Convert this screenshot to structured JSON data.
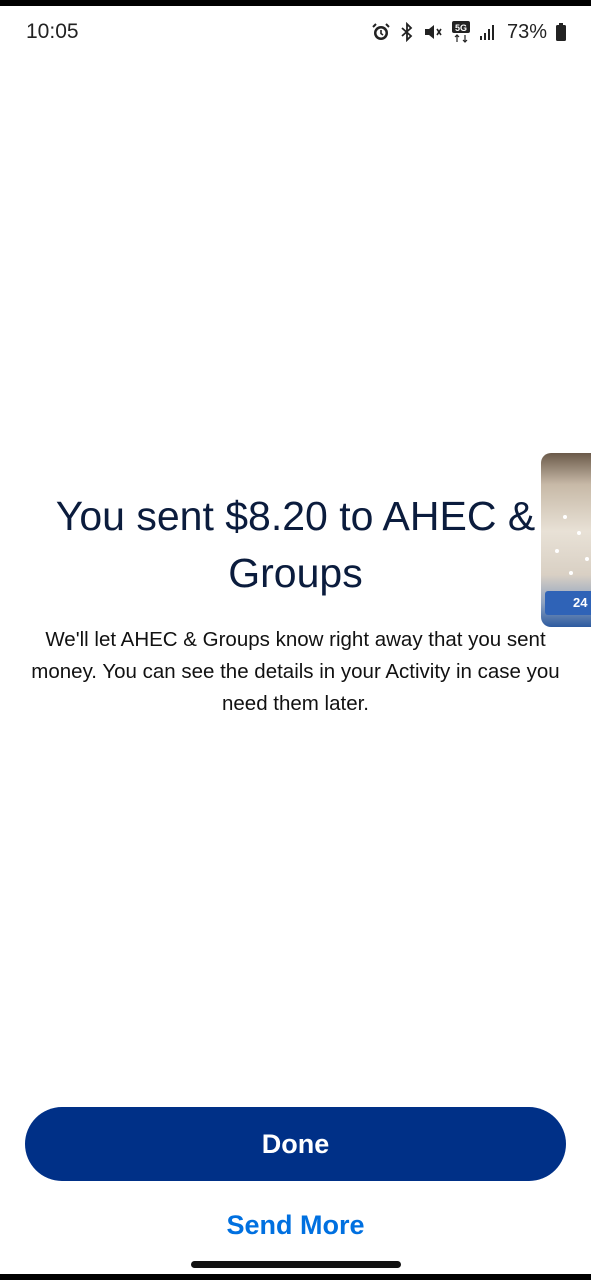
{
  "status_bar": {
    "time": "10:05",
    "icons": [
      "alarm-icon",
      "bluetooth-icon",
      "mute-icon",
      "5g-icon",
      "signal-icon"
    ],
    "battery": "73%"
  },
  "confirmation": {
    "title": "You sent $8.20 to AHEC & Groups",
    "description": "We'll let AHEC & Groups know right away that you sent money. You can see the details in your Activity in case you need them later."
  },
  "pip_overlay": {
    "badge": "24"
  },
  "actions": {
    "done_label": "Done",
    "send_more_label": "Send More"
  },
  "colors": {
    "primary_button": "#003087",
    "link": "#0070e0",
    "title_text": "#0b1c3d"
  }
}
